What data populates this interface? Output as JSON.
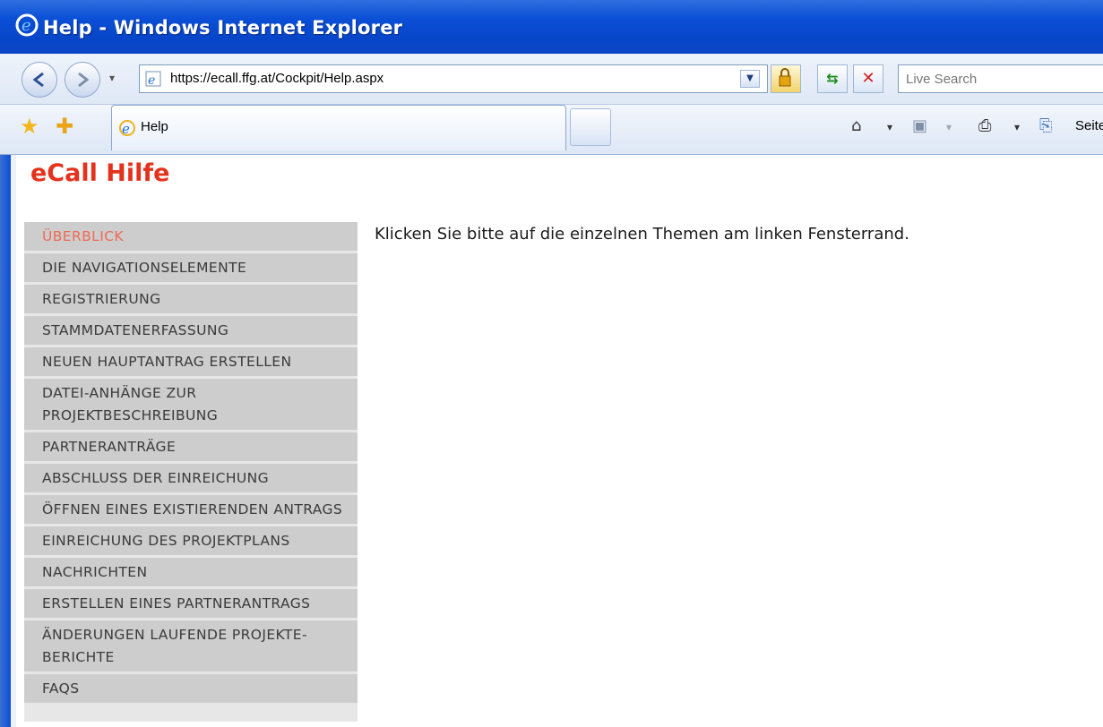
{
  "window": {
    "title": "Help - Windows Internet Explorer"
  },
  "address_bar": {
    "url": "https://ecall.ffg.at/Cockpit/Help.aspx",
    "search_placeholder": "Live Search"
  },
  "tabs": [
    {
      "label": "Help"
    }
  ],
  "command_bar": {
    "page_label": "Seite"
  },
  "page": {
    "title": "eCall Hilfe",
    "intro": "Klicken Sie bitte auf die einzelnen Themen am linken Fensterrand.",
    "sidebar": {
      "items": [
        {
          "label": "ÜBERBLICK"
        },
        {
          "label": "DIE NAVIGATIONSELEMENTE"
        },
        {
          "label": "REGISTRIERUNG"
        },
        {
          "label": "STAMMDATENERFASSUNG"
        },
        {
          "label": "NEUEN HAUPTANTRAG ERSTELLEN"
        },
        {
          "label": "DATEI-ANHÄNGE ZUR PROJEKTBESCHREIBUNG"
        },
        {
          "label": "PARTNERANTRÄGE"
        },
        {
          "label": "ABSCHLUSS DER EINREICHUNG"
        },
        {
          "label": "ÖFFNEN EINES EXISTIERENDEN ANTRAGS"
        },
        {
          "label": "EINREICHUNG DES PROJEKTPLANS"
        },
        {
          "label": "NACHRICHTEN"
        },
        {
          "label": "ERSTELLEN EINES PARTNERANTRAGS"
        },
        {
          "label": "ÄNDERUNGEN LAUFENDE PROJEKTE-BERICHTE"
        },
        {
          "label": "FAQS"
        }
      ]
    }
  },
  "colors": {
    "title_red": "#e5321d",
    "active_link": "#ef6a55",
    "menu_bg": "#cdcdcd",
    "titlebar_blue": "#0a4fd6"
  },
  "icons": [
    "ie-logo-icon",
    "back-icon",
    "forward-icon",
    "page-icon",
    "lock-icon",
    "refresh-icon",
    "stop-icon",
    "favorites-star-icon",
    "add-favorites-icon",
    "home-icon",
    "feeds-icon",
    "print-icon",
    "page-menu-icon"
  ]
}
